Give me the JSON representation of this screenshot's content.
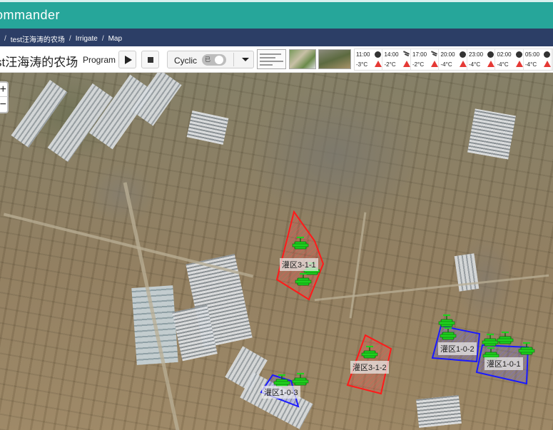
{
  "app": {
    "title": "ommander"
  },
  "breadcrumb": {
    "items": [
      "test汪海涛的农场",
      "Irrigate",
      "Map"
    ]
  },
  "toolbar": {
    "farm_title": "st汪海涛的农场",
    "program_label": "Program",
    "cyclic_label": "Cyclic",
    "toggle_text": "已"
  },
  "weather": [
    {
      "time": "11:00",
      "temp": "-3°C",
      "icon": "clear-moon-icon"
    },
    {
      "time": "14:00",
      "temp": "-2°C",
      "icon": "wind-icon"
    },
    {
      "time": "17:00",
      "temp": "-2°C",
      "icon": "wind-icon"
    },
    {
      "time": "20:00",
      "temp": "-4°C",
      "icon": "clear-moon-icon"
    },
    {
      "time": "23:00",
      "temp": "-4°C",
      "icon": "clear-moon-icon"
    },
    {
      "time": "02:00",
      "temp": "-4°C",
      "icon": "clear-moon-icon"
    },
    {
      "time": "05:00",
      "temp": "-4°C",
      "icon": "clear-moon-icon"
    }
  ],
  "map": {
    "zoom_in": "+",
    "zoom_out": "−",
    "zones": [
      {
        "label": "灌区3-1-1",
        "color": "#ff1a1a"
      },
      {
        "label": "灌区3-1-2",
        "color": "#ff1a1a"
      },
      {
        "label": "灌区1-0-3",
        "color": "#1a1aff"
      },
      {
        "label": "灌区1-0-2",
        "color": "#1a1aff"
      },
      {
        "label": "灌区1-0-1",
        "color": "#1a1aff"
      }
    ]
  },
  "colors": {
    "appbar": "#26a69a",
    "breadcrumb_bar": "#2c3e66",
    "valve": "#1fd11f"
  }
}
